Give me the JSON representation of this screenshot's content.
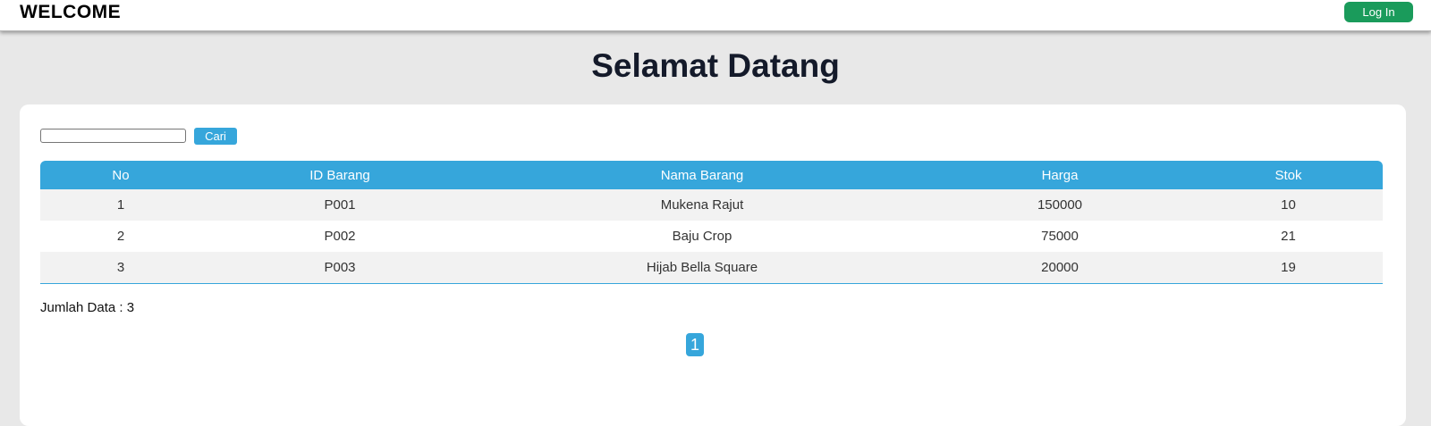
{
  "header": {
    "brand": "WELCOME",
    "login_label": "Log In"
  },
  "main": {
    "title": "Selamat Datang"
  },
  "search": {
    "value": "",
    "button_label": "Cari"
  },
  "table": {
    "columns": [
      "No",
      "ID Barang",
      "Nama Barang",
      "Harga",
      "Stok"
    ],
    "rows": [
      [
        "1",
        "P001",
        "Mukena Rajut",
        "150000",
        "10"
      ],
      [
        "2",
        "P002",
        "Baju Crop",
        "75000",
        "21"
      ],
      [
        "3",
        "P003",
        "Hijab Bella Square",
        "20000",
        "19"
      ]
    ]
  },
  "summary": {
    "count_label": "Jumlah Data : 3"
  },
  "pagination": {
    "current_page": "1"
  },
  "colors": {
    "accent": "#36a6db",
    "login": "#1a9b5b",
    "background": "#e8e8e8"
  }
}
